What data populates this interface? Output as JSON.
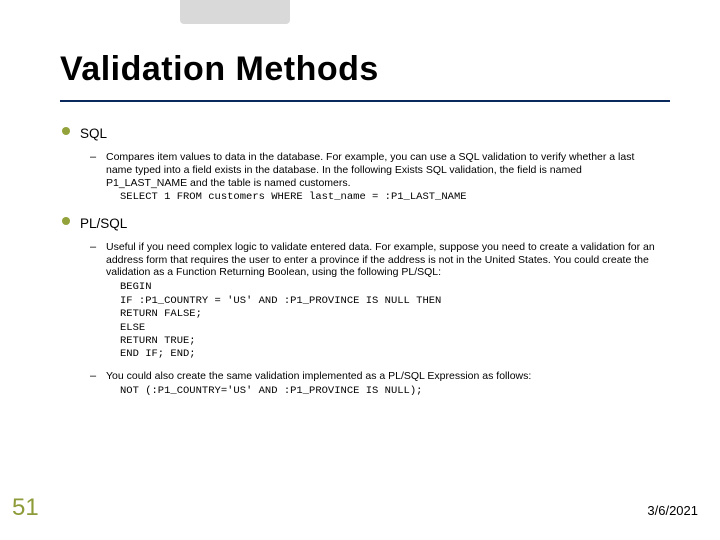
{
  "title": "Validation Methods",
  "items": [
    {
      "label": "SQL",
      "subs": [
        {
          "text": "Compares item values to data in the database. For example, you can use a SQL validation to verify whether a last name typed into a field exists in the database. In the following Exists SQL validation, the field is named P1_LAST_NAME and the table is named customers.",
          "code": "SELECT 1 FROM customers WHERE last_name = :P1_LAST_NAME"
        }
      ]
    },
    {
      "label": "PL/SQL",
      "subs": [
        {
          "text": "Useful if you need complex logic to validate entered data. For example, suppose you need to create a validation for an address form that requires the user to enter a province if the address is not in the United States. You could create the validation as a Function Returning Boolean, using the following PL/SQL:",
          "code": "BEGIN\nIF :P1_COUNTRY = 'US' AND :P1_PROVINCE IS NULL THEN\nRETURN FALSE;\nELSE\nRETURN TRUE;\nEND IF; END;"
        },
        {
          "text": "You could also create the same validation implemented as a PL/SQL Expression as follows:",
          "code": "NOT (:P1_COUNTRY='US' AND :P1_PROVINCE IS NULL);"
        }
      ]
    }
  ],
  "page_number": "51",
  "date": "3/6/2021"
}
